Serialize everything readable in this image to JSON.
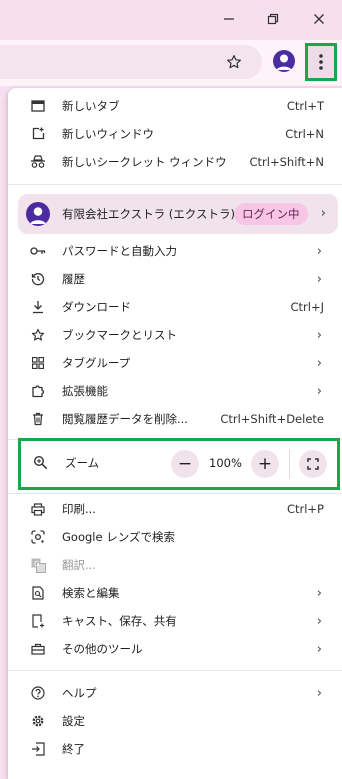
{
  "window": {
    "minimize_icon": "minimize-icon",
    "restore_icon": "restore-icon",
    "close_icon": "close-icon"
  },
  "toolbar": {
    "bookmark_icon": "star-icon",
    "menu_icon": "kebab-icon",
    "highlight_color": "#1aa64c"
  },
  "menu": {
    "new_tab": {
      "label": "新しいタブ",
      "shortcut": "Ctrl+T"
    },
    "new_window": {
      "label": "新しいウィンドウ",
      "shortcut": "Ctrl+N"
    },
    "new_incognito": {
      "label": "新しいシークレット ウィンドウ",
      "shortcut": "Ctrl+Shift+N"
    },
    "profile": {
      "name": "有限会社エクストラ (エクストラ)",
      "badge": "ログイン中"
    },
    "passwords": {
      "label": "パスワードと自動入力"
    },
    "history": {
      "label": "履歴"
    },
    "downloads": {
      "label": "ダウンロード",
      "shortcut": "Ctrl+J"
    },
    "bookmarks": {
      "label": "ブックマークとリスト"
    },
    "tab_groups": {
      "label": "タブグループ"
    },
    "extensions": {
      "label": "拡張機能"
    },
    "clear_data": {
      "label": "閲覧履歴データを削除...",
      "shortcut": "Ctrl+Shift+Delete"
    },
    "zoom": {
      "label": "ズーム",
      "value": "100%",
      "minus": "−",
      "plus": "+"
    },
    "print": {
      "label": "印刷...",
      "shortcut": "Ctrl+P"
    },
    "google_lens": {
      "label": "Google レンズで検索"
    },
    "translate": {
      "label": "翻訳..."
    },
    "find_edit": {
      "label": "検索と編集"
    },
    "cast_save_share": {
      "label": "キャスト、保存、共有"
    },
    "more_tools": {
      "label": "その他のツール"
    },
    "help": {
      "label": "ヘルプ"
    },
    "settings": {
      "label": "設定"
    },
    "exit": {
      "label": "終了"
    }
  }
}
